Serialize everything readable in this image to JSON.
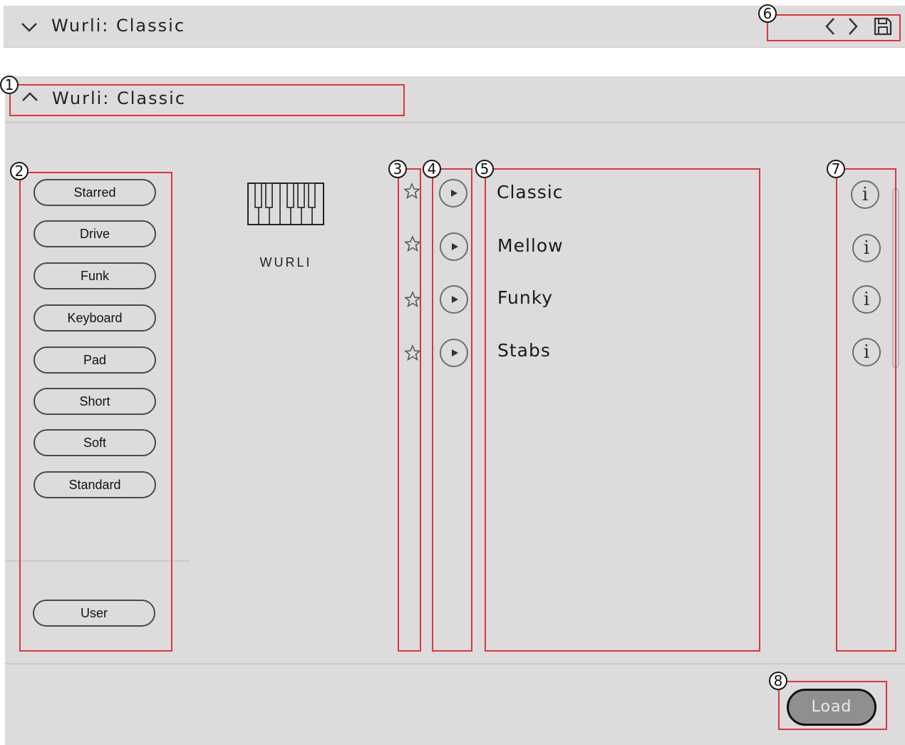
{
  "header": {
    "preset_name": "Wurli: Classic",
    "collapse_icon": "chevron-down-icon",
    "prev_icon": "chevron-left-icon",
    "next_icon": "chevron-right-icon",
    "save_icon": "save-icon"
  },
  "browser": {
    "title": "Wurli: Classic",
    "collapse_icon": "chevron-up-icon",
    "instrument_label": "WURLI",
    "instrument_icon": "keyboard-icon",
    "tags": [
      "Starred",
      "Drive",
      "Funk",
      "Keyboard",
      "Pad",
      "Short",
      "Soft",
      "Standard"
    ],
    "user_tag": "User",
    "presets": [
      "Classic",
      "Mellow",
      "Funky",
      "Stabs"
    ],
    "load_label": "Load"
  },
  "callouts": [
    "1",
    "2",
    "3",
    "4",
    "5",
    "6",
    "7",
    "8"
  ],
  "colors": {
    "panel_bg": "#dcdcdc",
    "highlight_box": "#e0353a",
    "load_button": "#8f8f8f"
  }
}
